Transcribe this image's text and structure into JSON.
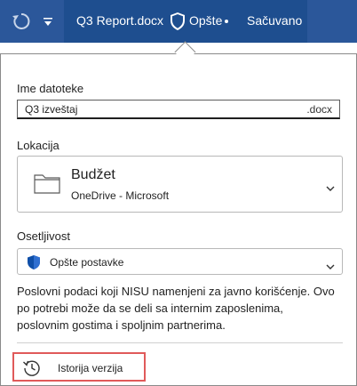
{
  "titlebar": {
    "doc_name": "Q3 Report.docx",
    "sensitivity": "Opšte",
    "save_status": "Sačuvano",
    "icons": [
      "undo-icon",
      "customize-quick-access-icon",
      "shield-icon"
    ]
  },
  "file_name": {
    "label": "Ime datoteke",
    "value": "Q3 izveštaj",
    "extension": ".docx"
  },
  "location": {
    "label": "Lokacija",
    "folder": "Budžet",
    "service": "OneDrive - Microsoft",
    "icon": "folder-icon"
  },
  "sensitivity": {
    "label": "Osetljivost",
    "selected": "Opšte postavke",
    "description": "Poslovni podaci koji NISU namenjeni za javno korišćenje. Ovo po potrebi može da se deli sa internim zaposlenima, poslovnim gostima i spoljnim partnerima.",
    "icon": "shield-icon"
  },
  "version_history": {
    "label": "Istorija verzija",
    "icon": "history-icon"
  },
  "colors": {
    "titlebar": "#2b579a",
    "title_strip": "#1e4e8f",
    "shield": "#0f4fa8",
    "highlight": "#e05a5a"
  }
}
